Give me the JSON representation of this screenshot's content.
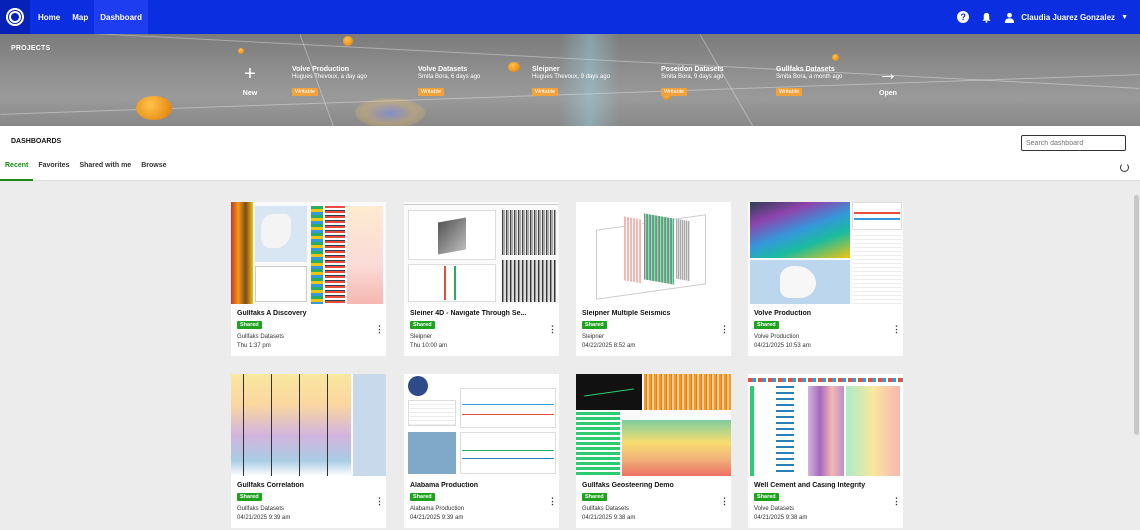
{
  "nav": {
    "items": [
      {
        "label": "Home"
      },
      {
        "label": "Map"
      },
      {
        "label": "Dashboard"
      }
    ]
  },
  "user": {
    "name": "Claudia Juarez Gonzalez"
  },
  "projects": {
    "title": "PROJECTS",
    "new_label": "New",
    "open_label": "Open",
    "items": [
      {
        "name": "Volve Production",
        "meta": "Hugues Thevoux, a day ago",
        "tag": "Writable"
      },
      {
        "name": "Volve Datasets",
        "meta": "Smita Bora, 6 days ago",
        "tag": "Writable"
      },
      {
        "name": "Sleipner",
        "meta": "Hugues Thevoux, 9 days ago",
        "tag": "Writable"
      },
      {
        "name": "Poseidon Datasets",
        "meta": "Smita Bora, 9 days ago",
        "tag": "Writable"
      },
      {
        "name": "Gullfaks Datasets",
        "meta": "Smita Bora, a month ago",
        "tag": "Writable"
      }
    ]
  },
  "dashboards": {
    "title": "DASHBOARDS",
    "search_placeholder": "Search dashboard",
    "tabs": [
      {
        "label": "Recent"
      },
      {
        "label": "Favorites"
      },
      {
        "label": "Shared with me"
      },
      {
        "label": "Browse"
      }
    ],
    "cards": [
      {
        "title": "Gullfaks A Discovery",
        "badge": "Shared",
        "project": "Gullfaks Datasets",
        "date": "Thu 1:37 pm"
      },
      {
        "title": "Sleiner 4D - Navigate Through Se...",
        "badge": "Shared",
        "project": "Sleipner",
        "date": "Thu 10:00 am"
      },
      {
        "title": "Sleipner Multiple Seismics",
        "badge": "Shared",
        "project": "Sleipner",
        "date": "04/22/2025 8:52 am"
      },
      {
        "title": "Volve Production",
        "badge": "Shared",
        "project": "Volve Production",
        "date": "04/21/2025 10:53 am"
      },
      {
        "title": "Gullfaks Correlation",
        "badge": "Shared",
        "project": "Gullfaks Datasets",
        "date": "04/21/2025 9:39 am"
      },
      {
        "title": "Alabama Production",
        "badge": "Shared",
        "project": "Alabama Production",
        "date": "04/21/2025 9:39 am"
      },
      {
        "title": "Gullfaks Geosteering Demo",
        "badge": "Shared",
        "project": "Gullfaks Datasets",
        "date": "04/21/2025 9:38 am"
      },
      {
        "title": "Well Cement and Casing Integrity",
        "badge": "Shared",
        "project": "Volve Datasets",
        "date": "04/21/2025 9:38 am"
      }
    ]
  },
  "colors": {
    "topbar": "#0a2ee0",
    "active_tab": "#1a8a1a",
    "shared_badge": "#1fa31f",
    "writable_tag": "#f2a23a"
  }
}
